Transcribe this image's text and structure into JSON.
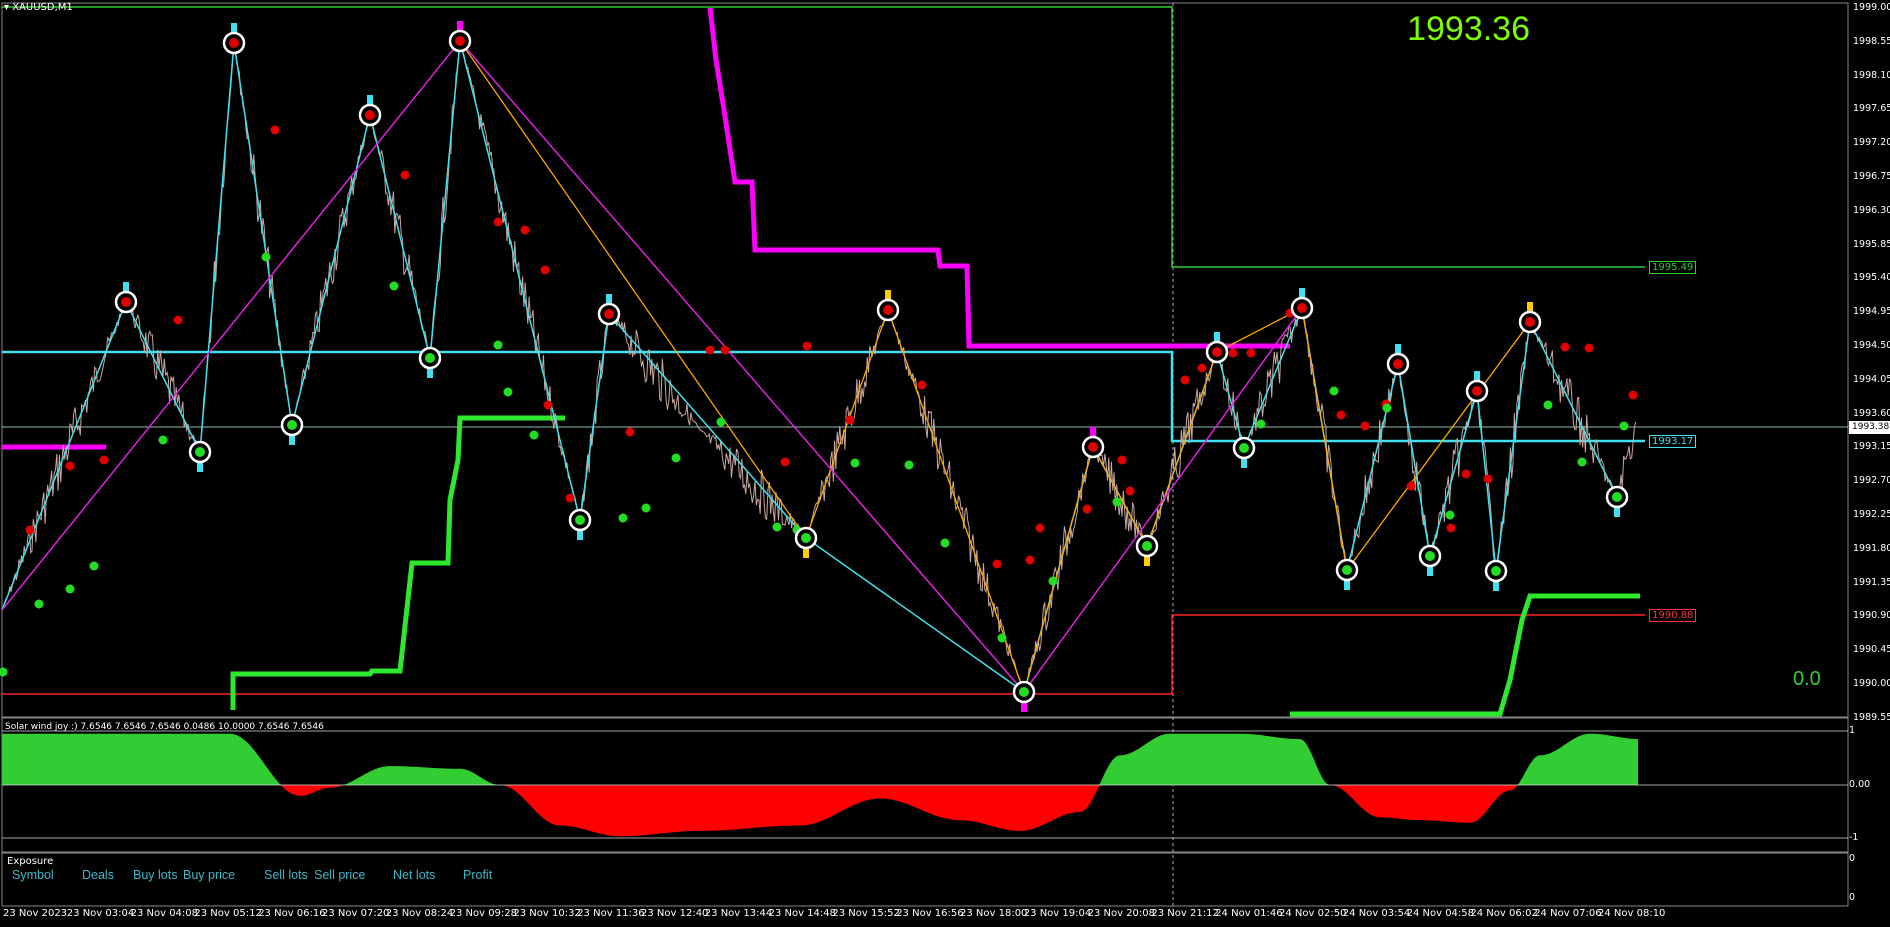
{
  "chart_header": {
    "symbol": "XAUUSD,M1",
    "current_price_big": "1993.36",
    "indicator_value": "0.0"
  },
  "price_axis": {
    "labels": [
      "1999.00",
      "1998.55",
      "1998.10",
      "1997.65",
      "1997.20",
      "1996.75",
      "1996.30",
      "1995.85",
      "1995.40",
      "1994.95",
      "1994.50",
      "1994.05",
      "1993.60",
      "1993.15",
      "1992.70",
      "1992.25",
      "1991.80",
      "1991.35",
      "1990.90",
      "1990.45",
      "1990.00",
      "1989.55"
    ]
  },
  "price_tags": {
    "current": "1993.38",
    "green_level": "1995.49",
    "cyan_level": "1993.17",
    "red_level": "1990.88"
  },
  "oscillator": {
    "label": "Solar wind joy :) 7.6546 7.6546 7.6546 0.0486 10.0000 7.6546 7.6546",
    "axis_top": "1",
    "axis_mid": "0.00",
    "axis_bottom": "-1"
  },
  "exposure": {
    "title": "Exposure",
    "columns": [
      "Symbol",
      "Deals",
      "Buy lots",
      "Buy price",
      "Sell lots",
      "Sell price",
      "Net lots",
      "Profit"
    ],
    "axis_top": "0",
    "axis_bottom": "0"
  },
  "time_axis": {
    "labels": [
      "23 Nov 2023",
      "23 Nov 03:04",
      "23 Nov 04:08",
      "23 Nov 05:12",
      "23 Nov 06:16",
      "23 Nov 07:20",
      "23 Nov 08:24",
      "23 Nov 09:28",
      "23 Nov 10:32",
      "23 Nov 11:36",
      "23 Nov 12:40",
      "23 Nov 13:44",
      "23 Nov 14:48",
      "23 Nov 15:52",
      "23 Nov 16:56",
      "23 Nov 18:00",
      "23 Nov 19:04",
      "23 Nov 20:08",
      "23 Nov 21:12",
      "24 Nov 01:46",
      "24 Nov 02:50",
      "24 Nov 03:54",
      "24 Nov 04:58",
      "24 Nov 06:02",
      "24 Nov 07:06",
      "24 Nov 08:10"
    ]
  },
  "colors": {
    "cyan": "#40e0f0",
    "magenta": "#ff00ff",
    "orange": "#ffa500",
    "green": "#32cd32",
    "red": "#ff0000",
    "price_line": "#c8a8a0"
  }
}
